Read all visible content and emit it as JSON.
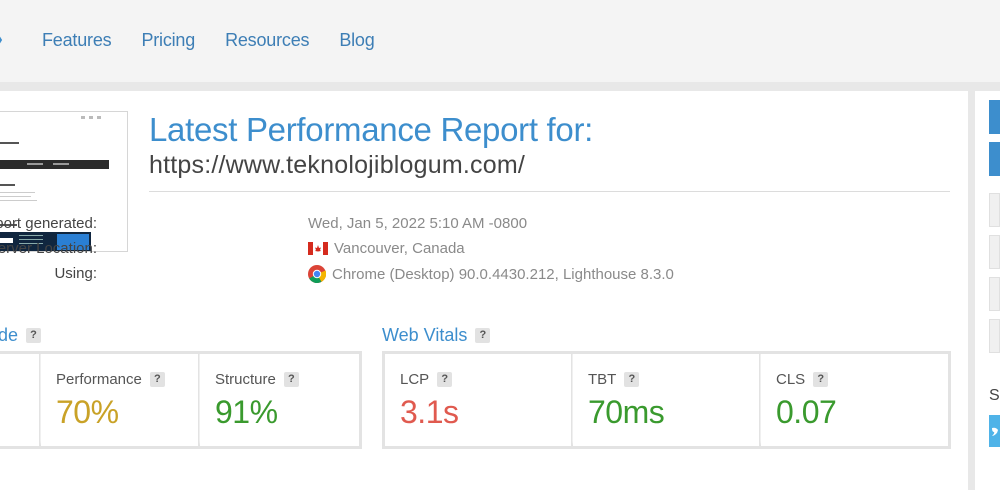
{
  "nav": {
    "items": [
      "Features",
      "Pricing",
      "Resources",
      "Blog"
    ]
  },
  "report": {
    "title": "Latest Performance Report for:",
    "url": "https://www.teknolojiblogum.com/",
    "meta": {
      "generated_label": "Report generated:",
      "generated_value": "Wed, Jan 5, 2022 5:10 AM -0800",
      "location_label": "Test Server Location:",
      "location_value": "Vancouver, Canada",
      "using_label": "Using:",
      "using_value": "Chrome (Desktop) 90.0.4430.212, Lighthouse 8.3.0"
    }
  },
  "grade": {
    "title_fragment": "de",
    "metrics": [
      {
        "label": "Performance",
        "value": "70%",
        "color": "#c9a227"
      },
      {
        "label": "Structure",
        "value": "91%",
        "color": "#3a9a2e"
      }
    ]
  },
  "web_vitals": {
    "title": "Web Vitals",
    "metrics": [
      {
        "label": "LCP",
        "value": "3.1s",
        "color": "#e05a4f"
      },
      {
        "label": "TBT",
        "value": "70ms",
        "color": "#3a9a2e"
      },
      {
        "label": "CLS",
        "value": "0.07",
        "color": "#3a9a2e"
      }
    ]
  },
  "help_glyph": "?",
  "sidebar": {
    "share_letter": "S"
  },
  "colors": {
    "accent": "#3d8ecd",
    "nav_link": "#3d7eb5"
  },
  "icons": {
    "flag": "canada-flag-icon",
    "browser": "chrome-icon",
    "help": "help-icon"
  }
}
